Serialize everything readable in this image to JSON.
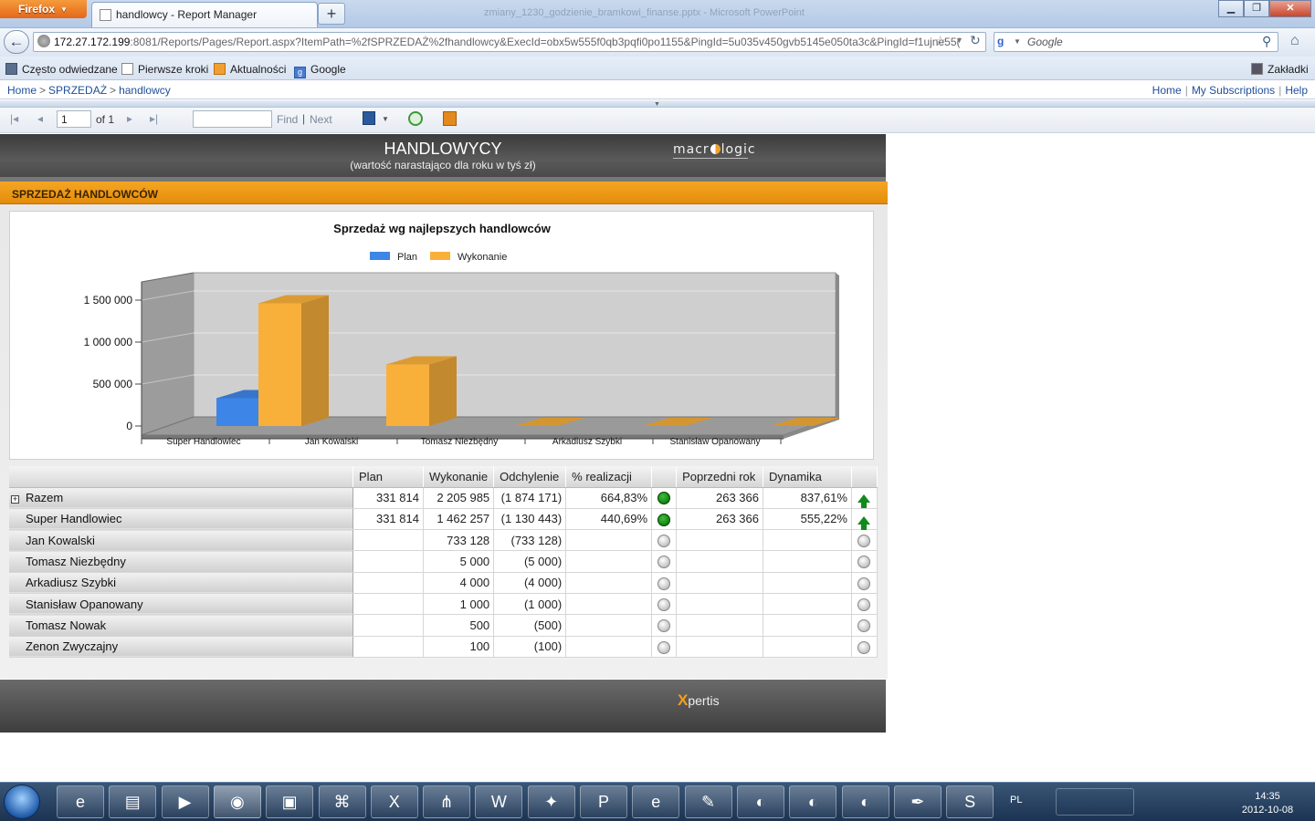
{
  "browser": {
    "app_button": "Firefox",
    "tab_title": "handlowcy - Report Manager",
    "new_tab": "+",
    "window_title": "zmiany_1230_godzienie_bramkowi_finanse.pptx - Microsoft PowerPoint",
    "url_host": "172.27.172.199",
    "url_rest": ":8081/Reports/Pages/Report.aspx?ItemPath=%2fSPRZEDAŻ%2fhandlowcy&ExecId=obx5w555f0qb3pqfi0po1155&PingId=5u035v450gvb5145e050ta3c&PingId=f1ujne55(",
    "search_placeholder": "Google",
    "bookmarks": [
      "Często odwiedzane",
      "Pierwsze kroki",
      "Aktualności",
      "Google"
    ],
    "bookmarks_right": "Zakładki"
  },
  "report_manager": {
    "breadcrumb": [
      "Home",
      "SPRZEDAŻ",
      "handlowcy"
    ],
    "links": [
      "Home",
      "My Subscriptions",
      "Help"
    ],
    "page_value": "1",
    "of_pages": "of 1",
    "find_label": "Find",
    "next_label": "Next"
  },
  "report": {
    "title": "HANDLOWYCY",
    "subtitle": "(wartość narastająco dla roku w tyś zł)",
    "logo_left": "macr",
    "logo_right": "logic",
    "section_title": "SPRZEDAŻ HANDLOWCÓW",
    "footer_logo_x": "X",
    "footer_logo_rest": "pertis"
  },
  "chart_data": {
    "type": "bar",
    "title": "Sprzedaż wg najlepszych handlowców",
    "categories": [
      "Super Handlowiec",
      "Jan Kowalski",
      "Tomasz Niezbędny",
      "Arkadiusz Szybki",
      "Stanisław Opanowany"
    ],
    "series": [
      {
        "name": "Plan",
        "values": [
          331814,
          0,
          0,
          0,
          0
        ],
        "color": "#3d85e6"
      },
      {
        "name": "Wykonanie",
        "values": [
          1462257,
          733128,
          5000,
          4000,
          1000
        ],
        "color": "#f9b03b"
      }
    ],
    "ylim": [
      0,
      1500000
    ],
    "yticks": [
      0,
      500000,
      1000000,
      1500000
    ],
    "ytick_labels": [
      "0",
      "500 000",
      "1 000 000",
      "1 500 000"
    ],
    "legend_placement": "top-center",
    "grid": true,
    "three_d": true
  },
  "table": {
    "headers": [
      "Plan",
      "Wykonanie",
      "Odchylenie",
      "% realizacji",
      "Poprzedni rok",
      "Dynamika"
    ],
    "rows": [
      {
        "name": "Razem",
        "plan": "331 814",
        "wyk": "2 205 985",
        "odch": "(1 874 171)",
        "real": "664,83%",
        "real_ind": "green",
        "prev": "263 366",
        "dyn": "837,61%",
        "dyn_ind": "up",
        "expand": "+"
      },
      {
        "name": "Super Handlowiec",
        "plan": "331 814",
        "wyk": "1 462 257",
        "odch": "(1 130 443)",
        "real": "440,69%",
        "real_ind": "green",
        "prev": "263 366",
        "dyn": "555,22%",
        "dyn_ind": "up"
      },
      {
        "name": "Jan Kowalski",
        "plan": "",
        "wyk": "733 128",
        "odch": "(733 128)",
        "real": "",
        "real_ind": "gray",
        "prev": "",
        "dyn": "",
        "dyn_ind": "gray"
      },
      {
        "name": "Tomasz Niezbędny",
        "plan": "",
        "wyk": "5 000",
        "odch": "(5 000)",
        "real": "",
        "real_ind": "gray",
        "prev": "",
        "dyn": "",
        "dyn_ind": "gray"
      },
      {
        "name": "Arkadiusz Szybki",
        "plan": "",
        "wyk": "4 000",
        "odch": "(4 000)",
        "real": "",
        "real_ind": "gray",
        "prev": "",
        "dyn": "",
        "dyn_ind": "gray"
      },
      {
        "name": "Stanisław Opanowany",
        "plan": "",
        "wyk": "1 000",
        "odch": "(1 000)",
        "real": "",
        "real_ind": "gray",
        "prev": "",
        "dyn": "",
        "dyn_ind": "gray"
      },
      {
        "name": "Tomasz Nowak",
        "plan": "",
        "wyk": "500",
        "odch": "(500)",
        "real": "",
        "real_ind": "gray",
        "prev": "",
        "dyn": "",
        "dyn_ind": "gray"
      },
      {
        "name": "Zenon Zwyczajny",
        "plan": "",
        "wyk": "100",
        "odch": "(100)",
        "real": "",
        "real_ind": "gray",
        "prev": "",
        "dyn": "",
        "dyn_ind": "gray"
      }
    ]
  },
  "taskbar": {
    "apps": [
      "ie-icon",
      "explorer-icon",
      "media-player-icon",
      "firefox-icon",
      "save-disk-icon",
      "network-icon",
      "excel-icon",
      "app-orange-icon",
      "word-icon",
      "app-red-icon",
      "powerpoint-icon",
      "ie-icon",
      "paint-icon",
      "half-circle-icon",
      "half-circle-icon",
      "half-circle-icon",
      "pen-icon",
      "skype-icon"
    ],
    "language": "PL",
    "clock_time": "14:35",
    "clock_date": "2012-10-08"
  }
}
